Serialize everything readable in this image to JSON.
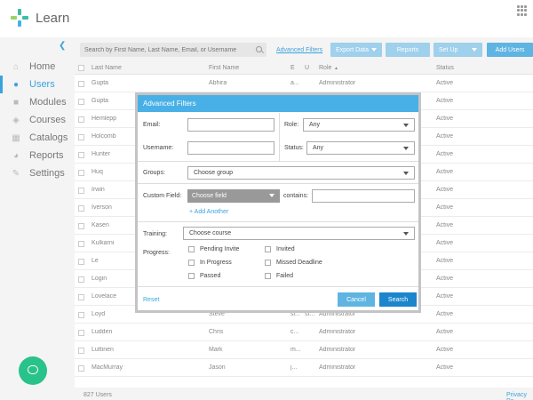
{
  "app": {
    "title": "Learn"
  },
  "sidebar": {
    "collapse_icon": "chevron-left-icon",
    "items": [
      {
        "label": "Home",
        "icon": "home-icon"
      },
      {
        "label": "Users",
        "icon": "user-icon",
        "active": true
      },
      {
        "label": "Modules",
        "icon": "cube-icon"
      },
      {
        "label": "Courses",
        "icon": "courses-icon"
      },
      {
        "label": "Catalogs",
        "icon": "grid-icon"
      },
      {
        "label": "Reports",
        "icon": "pie-chart-icon"
      },
      {
        "label": "Settings",
        "icon": "wrench-icon"
      }
    ]
  },
  "toolbar": {
    "search_placeholder": "Search by First Name, Last Name, Email, or Username",
    "advanced_filters_link": "Advanced Filters",
    "export_label": "Export Data",
    "reports_label": "Reports",
    "setup_label": "Set Up",
    "add_users_label": "Add Users"
  },
  "table": {
    "headers": {
      "last_name": "Last Name",
      "first_name": "First Name",
      "email": "E",
      "user": "U",
      "role": "Role",
      "sort_indicator": "▲",
      "status": "Status"
    },
    "rows": [
      {
        "last": "Gupta",
        "first": "Abhira",
        "email": "a...",
        "user": "",
        "role": "Administrator",
        "status": "Active"
      },
      {
        "last": "Gupta",
        "first": "",
        "email": "",
        "user": "",
        "role": "",
        "status": "Active"
      },
      {
        "last": "Hemlepp",
        "first": "",
        "email": "",
        "user": "",
        "role": "",
        "status": "Active"
      },
      {
        "last": "Holcomb",
        "first": "",
        "email": "",
        "user": "",
        "role": "",
        "status": "Active"
      },
      {
        "last": "Hunter",
        "first": "",
        "email": "",
        "user": "",
        "role": "",
        "status": "Active"
      },
      {
        "last": "Huq",
        "first": "",
        "email": "",
        "user": "",
        "role": "",
        "status": "Active"
      },
      {
        "last": "Irwin",
        "first": "",
        "email": "",
        "user": "",
        "role": "",
        "status": "Active"
      },
      {
        "last": "Iverson",
        "first": "",
        "email": "",
        "user": "",
        "role": "",
        "status": "Active"
      },
      {
        "last": "Kasen",
        "first": "",
        "email": "",
        "user": "",
        "role": "",
        "status": "Active"
      },
      {
        "last": "Kulkarni",
        "first": "",
        "email": "",
        "user": "",
        "role": "",
        "status": "Active"
      },
      {
        "last": "Le",
        "first": "",
        "email": "",
        "user": "",
        "role": "",
        "status": "Active"
      },
      {
        "last": "Login",
        "first": "",
        "email": "",
        "user": "",
        "role": "",
        "status": "Active"
      },
      {
        "last": "Lovelace",
        "first": "",
        "email": "",
        "user": "",
        "role": "",
        "status": "Active"
      },
      {
        "last": "Loyd",
        "first": "Steve",
        "email": "sl...",
        "user": "st...",
        "role": "Administrator",
        "status": "Active"
      },
      {
        "last": "Ludden",
        "first": "Chris",
        "email": "c...",
        "user": "",
        "role": "Administrator",
        "status": "Active"
      },
      {
        "last": "Luttinen",
        "first": "Mark",
        "email": "m...",
        "user": "",
        "role": "Administrator",
        "status": "Active"
      },
      {
        "last": "MacMurray",
        "first": "Jason",
        "email": "j...",
        "user": "",
        "role": "Administrator",
        "status": "Active"
      }
    ],
    "footer_count": "827 Users",
    "privacy_link": "Privacy Pa"
  },
  "modal": {
    "title": "Advanced Filters",
    "email_label": "Email:",
    "role_label": "Role:",
    "role_value": "Any",
    "username_label": "Username:",
    "status_label": "Status:",
    "status_value": "Any",
    "groups_label": "Groups:",
    "groups_value": "Choose group",
    "custom_field_label": "Custom Field:",
    "custom_field_value": "Choose field",
    "contains_label": "contains:",
    "add_another": "+ Add Another",
    "training_label": "Training:",
    "training_value": "Choose course",
    "progress_label": "Progress:",
    "progress_options": [
      "Pending Invite",
      "Invited",
      "In Progress",
      "Missed Deadline",
      "Passed",
      "Failed"
    ],
    "reset_label": "Reset",
    "cancel_label": "Cancel",
    "search_label": "Search"
  },
  "colors": {
    "accent": "#48b0e6",
    "primary_button": "#1c85cc",
    "chat": "#29c28a"
  }
}
